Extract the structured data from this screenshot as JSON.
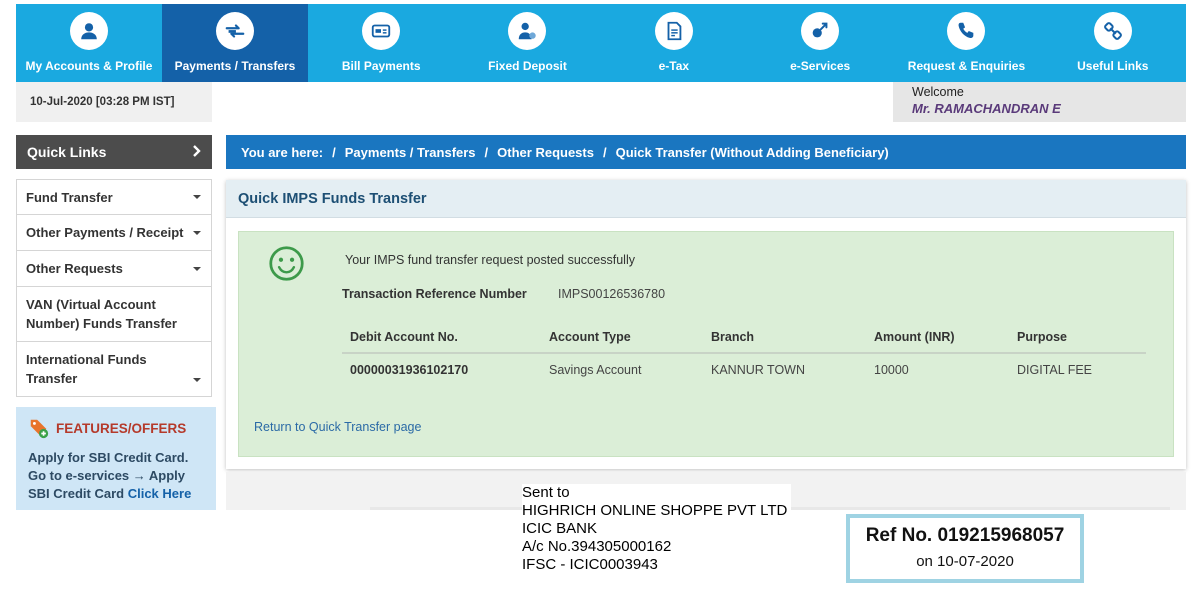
{
  "nav": [
    {
      "label": "My Accounts & Profile",
      "icon": "user-icon"
    },
    {
      "label": "Payments / Transfers",
      "icon": "transfer-icon",
      "active": true
    },
    {
      "label": "Bill Payments",
      "icon": "bill-icon"
    },
    {
      "label": "Fixed Deposit",
      "icon": "deposit-icon"
    },
    {
      "label": "e-Tax",
      "icon": "tax-icon"
    },
    {
      "label": "e-Services",
      "icon": "services-icon"
    },
    {
      "label": "Request & Enquiries",
      "icon": "phone-icon"
    },
    {
      "label": "Useful Links",
      "icon": "links-icon"
    }
  ],
  "datetime": "10-Jul-2020 [03:28 PM IST]",
  "welcome": {
    "label": "Welcome",
    "name": "Mr. RAMACHANDRAN E"
  },
  "sidebar": {
    "quick_links": "Quick Links",
    "items": [
      {
        "label": "Fund Transfer"
      },
      {
        "label": "Other Payments / Receipt"
      },
      {
        "label": "Other Requests"
      },
      {
        "label": "VAN (Virtual Account Number) Funds Transfer"
      },
      {
        "label": "International Funds Transfer"
      }
    ],
    "features": {
      "title": "FEATURES/OFFERS",
      "text": "Apply for SBI Credit Card. Go to e-services → Apply SBI Credit Card",
      "link": "Click Here"
    }
  },
  "breadcrumb": {
    "prefix": "You are here:",
    "items": [
      "Payments / Transfers",
      "Other Requests",
      "Quick Transfer (Without Adding Beneficiary)"
    ]
  },
  "panel": {
    "title": "Quick IMPS Funds Transfer",
    "success_message": "Your IMPS fund transfer request posted successfully",
    "txn_ref_label": "Transaction Reference Number",
    "txn_ref_value": "IMPS00126536780",
    "table": {
      "headers": [
        "Debit Account No.",
        "Account Type",
        "Branch",
        "Amount (INR)",
        "Purpose"
      ],
      "row": [
        "00000031936102170",
        "Savings Account",
        "KANNUR TOWN",
        "10000",
        "DIGITAL FEE"
      ]
    },
    "return_link": "Return to Quick Transfer page"
  },
  "overlay": {
    "sent_to": [
      "Sent to",
      "HIGHRICH ONLINE SHOPPE PVT LTD",
      "ICIC BANK",
      "A/c No.394305000162",
      "IFSC - ICIC0003943"
    ],
    "ref_no": "Ref No. 019215968057",
    "ref_date": "on 10-07-2020"
  },
  "colors": {
    "nav_bg": "#1aa9e0",
    "nav_active": "#1461a8",
    "breadcrumb_bg": "#1a76c0",
    "success_bg": "#dbeed7"
  }
}
